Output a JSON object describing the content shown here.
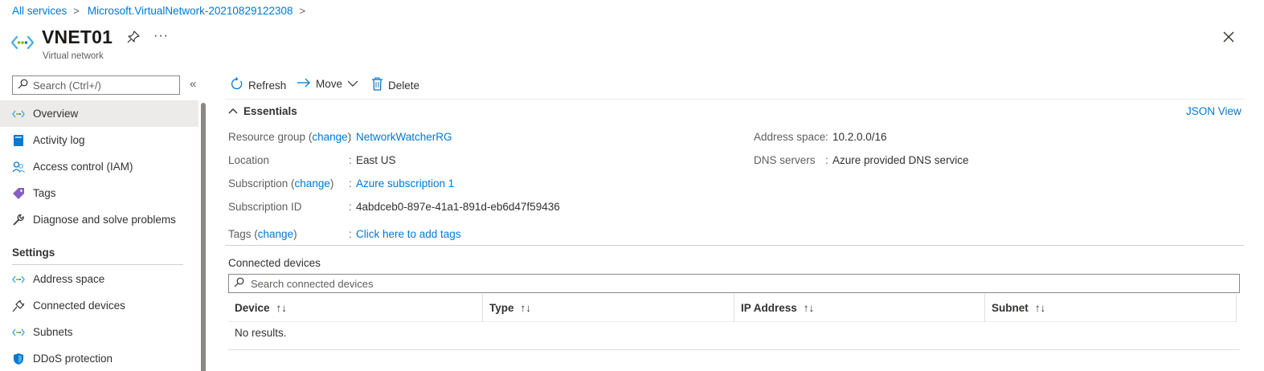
{
  "breadcrumb": {
    "items": [
      "All services",
      "Microsoft.VirtualNetwork-20210829122308"
    ],
    "separator": ">"
  },
  "header": {
    "title": "VNET01",
    "subtitle": "Virtual network",
    "more_label": "···"
  },
  "sidebar": {
    "search_placeholder": "Search (Ctrl+/)",
    "collapse_label": "«",
    "items": [
      {
        "label": "Overview",
        "icon": "vnet-icon",
        "selected": true
      },
      {
        "label": "Activity log",
        "icon": "activity-log-icon"
      },
      {
        "label": "Access control (IAM)",
        "icon": "people-icon"
      },
      {
        "label": "Tags",
        "icon": "tag-icon"
      },
      {
        "label": "Diagnose and solve problems",
        "icon": "wrench-icon"
      }
    ],
    "settings_title": "Settings",
    "settings_items": [
      {
        "label": "Address space",
        "icon": "vnet-icon"
      },
      {
        "label": "Connected devices",
        "icon": "plug-icon"
      },
      {
        "label": "Subnets",
        "icon": "vnet-icon"
      },
      {
        "label": "DDoS protection",
        "icon": "shield-icon"
      }
    ]
  },
  "toolbar": {
    "refresh_label": "Refresh",
    "move_label": "Move",
    "delete_label": "Delete"
  },
  "essentials": {
    "title": "Essentials",
    "json_view_label": "JSON View",
    "change_label": "change",
    "left": {
      "resource_group_label": "Resource group",
      "resource_group_value": "NetworkWatcherRG",
      "location_label": "Location",
      "location_value": "East US",
      "subscription_label": "Subscription",
      "subscription_value": "Azure subscription 1",
      "subscription_id_label": "Subscription ID",
      "subscription_id_value": "4abdceb0-897e-41a1-891d-eb6d47f59436",
      "tags_label": "Tags",
      "tags_value": "Click here to add tags"
    },
    "right": {
      "address_space_label": "Address space",
      "address_space_value": "10.2.0.0/16",
      "dns_label": "DNS servers",
      "dns_value": "Azure provided DNS service"
    }
  },
  "connected_devices": {
    "title": "Connected devices",
    "search_placeholder": "Search connected devices",
    "columns": [
      "Device",
      "Type",
      "IP Address",
      "Subnet"
    ],
    "sort_glyph": "↑↓",
    "empty_text": "No results."
  },
  "colors": {
    "link": "#0078d4",
    "selected_bg": "#edebe9",
    "text": "#323130",
    "muted": "#605e5c"
  }
}
